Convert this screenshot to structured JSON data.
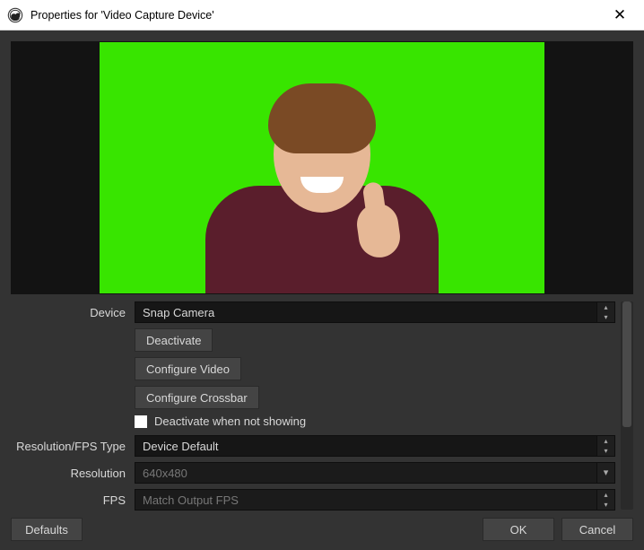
{
  "window": {
    "title": "Properties for 'Video Capture Device'"
  },
  "form": {
    "device_label": "Device",
    "device_value": "Snap Camera",
    "deactivate_button": "Deactivate",
    "configure_video_button": "Configure Video",
    "configure_crossbar_button": "Configure Crossbar",
    "deactivate_when_not_showing_label": "Deactivate when not showing",
    "resolution_fps_type_label": "Resolution/FPS Type",
    "resolution_fps_type_value": "Device Default",
    "resolution_label": "Resolution",
    "resolution_placeholder": "640x480",
    "fps_label": "FPS",
    "fps_placeholder": "Match Output FPS"
  },
  "footer": {
    "defaults": "Defaults",
    "ok": "OK",
    "cancel": "Cancel"
  }
}
